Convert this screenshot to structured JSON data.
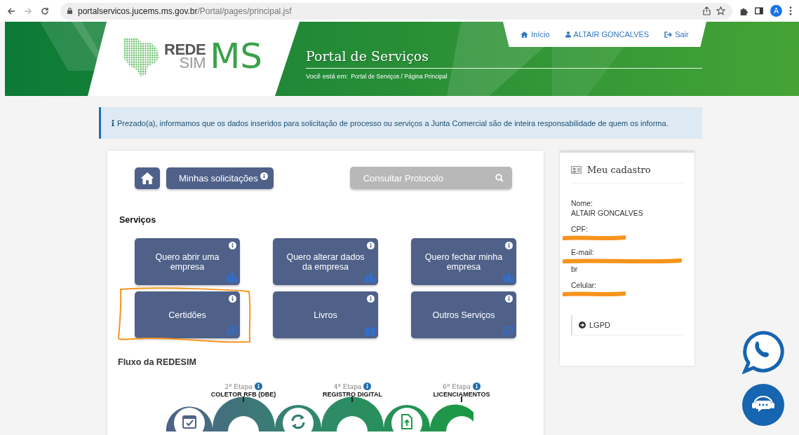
{
  "browser": {
    "url_host": "portalservicos.jucems.ms.gov.br",
    "url_path": "/Portal/pages/principal.jsf",
    "profile_initial": "A"
  },
  "header": {
    "logo": {
      "line1": "REDE",
      "line2": "SIM",
      "mark": "MS"
    },
    "title": "Portal de Serviços",
    "breadcrumb_label": "Você está em:",
    "breadcrumb": "Portal de Serviços / Página Principal",
    "nav": [
      {
        "kind": "home",
        "label": "Início"
      },
      {
        "kind": "user",
        "label": "ALTAIR GONCALVES"
      },
      {
        "kind": "logout",
        "label": "Sair"
      }
    ]
  },
  "notice": {
    "text": "Prezado(a), informamos que os dados inseridos para solicitação de processo ou serviços a Junta Comercial são de inteira responsabilidade de quem os informa."
  },
  "toolbar": {
    "requests_button": "Minhas solicitações",
    "search": {
      "placeholder": "Consultar Protocolo"
    }
  },
  "services": {
    "title": "Serviços",
    "tiles": [
      {
        "label": "Quero abrir uma empresa",
        "kind": "building",
        "highlighted": false
      },
      {
        "label": "Quero alterar dados da empresa",
        "kind": "building",
        "highlighted": false
      },
      {
        "label": "Quero fechar minha empresa",
        "kind": "building",
        "highlighted": false
      },
      {
        "label": "Certidões",
        "kind": "certificate",
        "highlighted": true
      },
      {
        "label": "Livros",
        "kind": "book",
        "highlighted": false
      },
      {
        "label": "Outros Serviços",
        "kind": "copy",
        "highlighted": false
      }
    ]
  },
  "flow": {
    "title": "Fluxo da REDESIM",
    "steps": [
      {
        "stage": "2ª Etapa",
        "name": "COLETOR RFB (DBE)"
      },
      {
        "stage": "4ª Etapa",
        "name": "REGISTRO DIGITAL"
      },
      {
        "stage": "6ª Etapa",
        "name": "LICENCIAMENTOS"
      }
    ]
  },
  "profile": {
    "title": "Meu cadastro",
    "fields": [
      {
        "label": "Nome:",
        "value": "ALTAIR GONCALVES",
        "redacted": false
      },
      {
        "label": "CPF:",
        "redacted": true
      },
      {
        "label": "E-mail:",
        "redacted": true,
        "value_tail": "br"
      },
      {
        "label": "Celular:",
        "redacted": true
      }
    ],
    "link": "LGPD"
  }
}
